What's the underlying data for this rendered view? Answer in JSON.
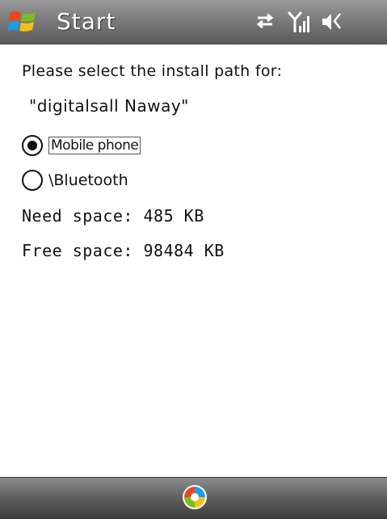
{
  "titlebar": {
    "title": "Start",
    "icons": [
      "windows-logo-icon",
      "connectivity-icon",
      "signal-icon",
      "volume-icon"
    ]
  },
  "installer": {
    "prompt": "Please select the install path for:",
    "app_name": "\"digitalsall Naway\"",
    "options": [
      {
        "label": "Mobile phone",
        "selected": true
      },
      {
        "label": "\\Bluetooth",
        "selected": false
      }
    ],
    "need_space": "Need space: 485 KB",
    "free_space": "Free space: 98484 KB"
  },
  "softbar": {
    "icon": "windows-start-icon"
  }
}
